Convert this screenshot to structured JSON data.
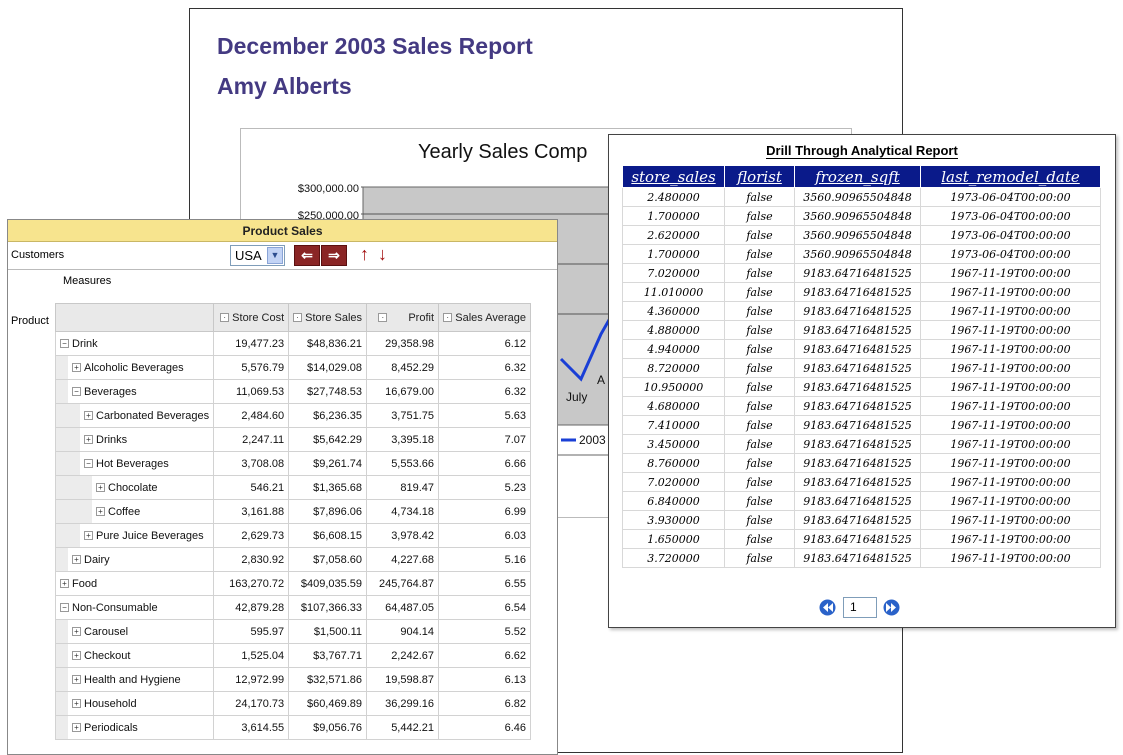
{
  "report": {
    "title": "December 2003 Sales Report",
    "author": "Amy Alberts"
  },
  "chart": {
    "title": "Yearly Sales Comp",
    "x_visible_labels": [
      "July",
      "A"
    ],
    "legend_fragment": "2003"
  },
  "chart_data": {
    "type": "line",
    "title": "Yearly Sales Comp",
    "y_tick_labels": [
      "$300,000.00",
      "$250,000.00"
    ],
    "categories": [
      "July",
      "A"
    ],
    "series": [
      {
        "name": "2003",
        "color": "#1a3fd6"
      }
    ],
    "grid": true
  },
  "product_sales": {
    "title": "Product Sales",
    "customers_label": "Customers",
    "customers_value": "USA",
    "measures_label": "Measures",
    "product_label": "Product",
    "columns": [
      "Store Cost",
      "Store Sales",
      "Profit",
      "Sales Average"
    ],
    "rows": [
      {
        "label": "Drink",
        "sign": "−",
        "indent": 0,
        "values": [
          "19,477.23",
          "$48,836.21",
          "29,358.98",
          "6.12"
        ]
      },
      {
        "label": "Alcoholic Beverages",
        "sign": "+",
        "indent": 1,
        "values": [
          "5,576.79",
          "$14,029.08",
          "8,452.29",
          "6.32"
        ]
      },
      {
        "label": "Beverages",
        "sign": "−",
        "indent": 1,
        "values": [
          "11,069.53",
          "$27,748.53",
          "16,679.00",
          "6.32"
        ]
      },
      {
        "label": "Carbonated Beverages",
        "sign": "+",
        "indent": 2,
        "values": [
          "2,484.60",
          "$6,236.35",
          "3,751.75",
          "5.63"
        ]
      },
      {
        "label": "Drinks",
        "sign": "+",
        "indent": 2,
        "values": [
          "2,247.11",
          "$5,642.29",
          "3,395.18",
          "7.07"
        ]
      },
      {
        "label": "Hot Beverages",
        "sign": "−",
        "indent": 2,
        "values": [
          "3,708.08",
          "$9,261.74",
          "5,553.66",
          "6.66"
        ]
      },
      {
        "label": "Chocolate",
        "sign": "+",
        "indent": 3,
        "values": [
          "546.21",
          "$1,365.68",
          "819.47",
          "5.23"
        ]
      },
      {
        "label": "Coffee",
        "sign": "+",
        "indent": 3,
        "values": [
          "3,161.88",
          "$7,896.06",
          "4,734.18",
          "6.99"
        ]
      },
      {
        "label": "Pure Juice Beverages",
        "sign": "+",
        "indent": 2,
        "values": [
          "2,629.73",
          "$6,608.15",
          "3,978.42",
          "6.03"
        ]
      },
      {
        "label": "Dairy",
        "sign": "+",
        "indent": 1,
        "values": [
          "2,830.92",
          "$7,058.60",
          "4,227.68",
          "5.16"
        ]
      },
      {
        "label": "Food",
        "sign": "+",
        "indent": 0,
        "values": [
          "163,270.72",
          "$409,035.59",
          "245,764.87",
          "6.55"
        ]
      },
      {
        "label": "Non-Consumable",
        "sign": "−",
        "indent": 0,
        "values": [
          "42,879.28",
          "$107,366.33",
          "64,487.05",
          "6.54"
        ]
      },
      {
        "label": "Carousel",
        "sign": "+",
        "indent": 1,
        "values": [
          "595.97",
          "$1,500.11",
          "904.14",
          "5.52"
        ]
      },
      {
        "label": "Checkout",
        "sign": "+",
        "indent": 1,
        "values": [
          "1,525.04",
          "$3,767.71",
          "2,242.67",
          "6.62"
        ]
      },
      {
        "label": "Health and Hygiene",
        "sign": "+",
        "indent": 1,
        "values": [
          "12,972.99",
          "$32,571.86",
          "19,598.87",
          "6.13"
        ]
      },
      {
        "label": "Household",
        "sign": "+",
        "indent": 1,
        "values": [
          "24,170.73",
          "$60,469.89",
          "36,299.16",
          "6.82"
        ]
      },
      {
        "label": "Periodicals",
        "sign": "+",
        "indent": 1,
        "values": [
          "3,614.55",
          "$9,056.76",
          "5,442.21",
          "6.46"
        ]
      }
    ]
  },
  "drill": {
    "title": "Drill Through Analytical Report",
    "columns": [
      "store_sales",
      "florist",
      "frozen_sqft",
      "last_remodel_date"
    ],
    "rows": [
      [
        "2.480000",
        "false",
        "3560.90965504848",
        "1973-06-04T00:00:00"
      ],
      [
        "1.700000",
        "false",
        "3560.90965504848",
        "1973-06-04T00:00:00"
      ],
      [
        "2.620000",
        "false",
        "3560.90965504848",
        "1973-06-04T00:00:00"
      ],
      [
        "1.700000",
        "false",
        "3560.90965504848",
        "1973-06-04T00:00:00"
      ],
      [
        "7.020000",
        "false",
        "9183.64716481525",
        "1967-11-19T00:00:00"
      ],
      [
        "11.010000",
        "false",
        "9183.64716481525",
        "1967-11-19T00:00:00"
      ],
      [
        "4.360000",
        "false",
        "9183.64716481525",
        "1967-11-19T00:00:00"
      ],
      [
        "4.880000",
        "false",
        "9183.64716481525",
        "1967-11-19T00:00:00"
      ],
      [
        "4.940000",
        "false",
        "9183.64716481525",
        "1967-11-19T00:00:00"
      ],
      [
        "8.720000",
        "false",
        "9183.64716481525",
        "1967-11-19T00:00:00"
      ],
      [
        "10.950000",
        "false",
        "9183.64716481525",
        "1967-11-19T00:00:00"
      ],
      [
        "4.680000",
        "false",
        "9183.64716481525",
        "1967-11-19T00:00:00"
      ],
      [
        "7.410000",
        "false",
        "9183.64716481525",
        "1967-11-19T00:00:00"
      ],
      [
        "3.450000",
        "false",
        "9183.64716481525",
        "1967-11-19T00:00:00"
      ],
      [
        "8.760000",
        "false",
        "9183.64716481525",
        "1967-11-19T00:00:00"
      ],
      [
        "7.020000",
        "false",
        "9183.64716481525",
        "1967-11-19T00:00:00"
      ],
      [
        "6.840000",
        "false",
        "9183.64716481525",
        "1967-11-19T00:00:00"
      ],
      [
        "3.930000",
        "false",
        "9183.64716481525",
        "1967-11-19T00:00:00"
      ],
      [
        "1.650000",
        "false",
        "9183.64716481525",
        "1967-11-19T00:00:00"
      ],
      [
        "3.720000",
        "false",
        "9183.64716481525",
        "1967-11-19T00:00:00"
      ]
    ],
    "page": "1"
  }
}
